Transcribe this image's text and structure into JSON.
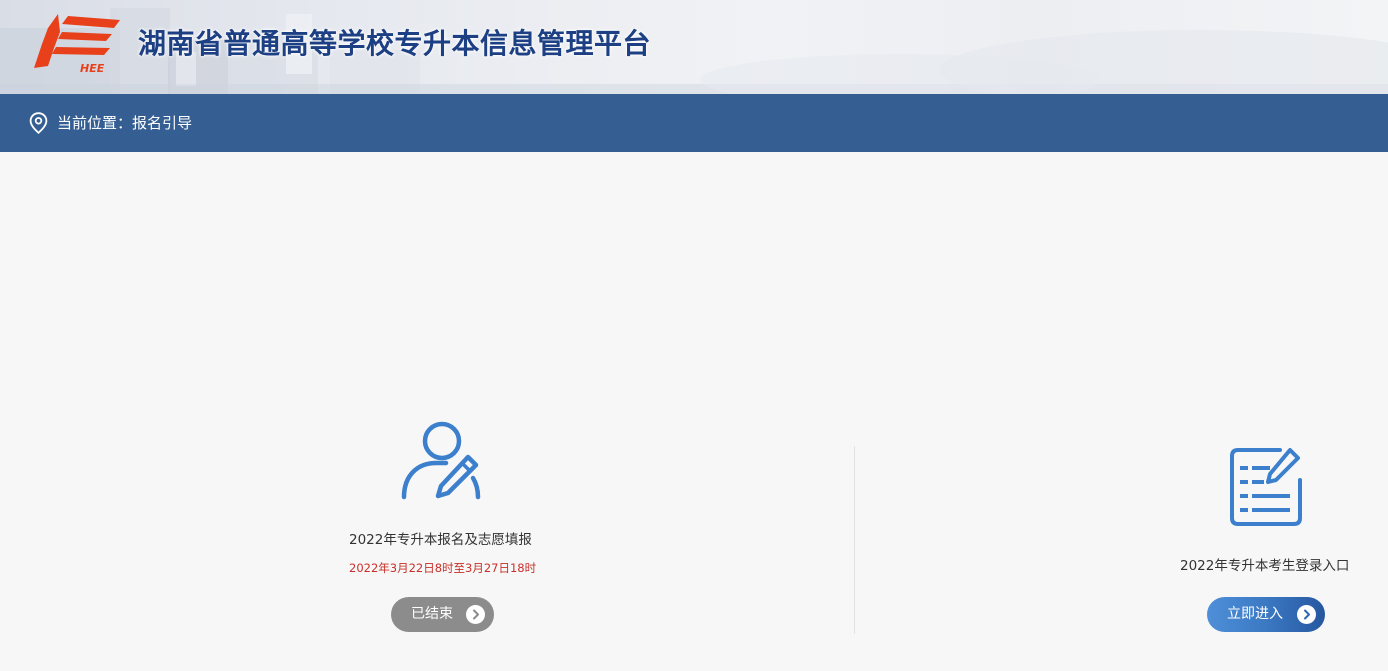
{
  "header": {
    "title": "湖南省普通高等学校专升本信息管理平台",
    "logo_text": "HEE",
    "colors": {
      "title": "#1d3f83",
      "logo": "#e8401a"
    }
  },
  "breadcrumb": {
    "icon": "location-pin-icon",
    "text": "当前位置：报名引导",
    "bar_color": "#355f93"
  },
  "cards": [
    {
      "icon": "user-edit-icon",
      "title": "2022年专升本报名及志愿填报",
      "time": "2022年3月22日8时至3月27日18时",
      "button": {
        "label": "已结束",
        "state": "disabled",
        "color": "#8c8c8c"
      }
    },
    {
      "icon": "form-edit-icon",
      "title": "2022年专升本考生登录入口",
      "button": {
        "label": "立即进入",
        "state": "active",
        "color": "#3b79c3"
      }
    }
  ]
}
